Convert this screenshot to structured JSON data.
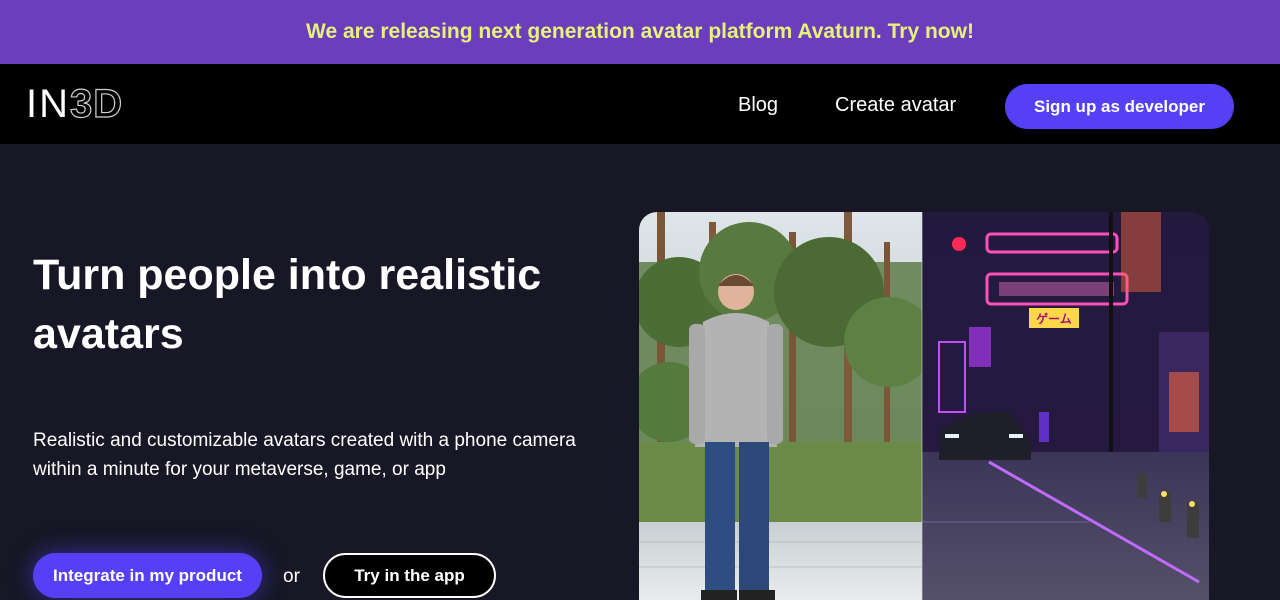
{
  "banner": {
    "text": "We are releasing next generation avatar platform Avaturn. Try now!"
  },
  "nav": {
    "logo_thin": "IN",
    "logo_mesh": "3D",
    "blog": "Blog",
    "create_avatar": "Create avatar",
    "signup": "Sign up as developer"
  },
  "hero": {
    "title": "Turn people into realistic avatars",
    "subtitle": "Realistic and customizable avatars created with a phone camera within a minute for your metaverse, game, or app",
    "integrate_button": "Integrate in my product",
    "or": "or",
    "try_button": "Try in the app",
    "image_signs": [
      "ゲーム"
    ]
  },
  "colors": {
    "banner_bg": "#6c3dbd",
    "banner_text": "#e6f27a",
    "accent": "#5640f6",
    "page_bg": "#171725"
  }
}
